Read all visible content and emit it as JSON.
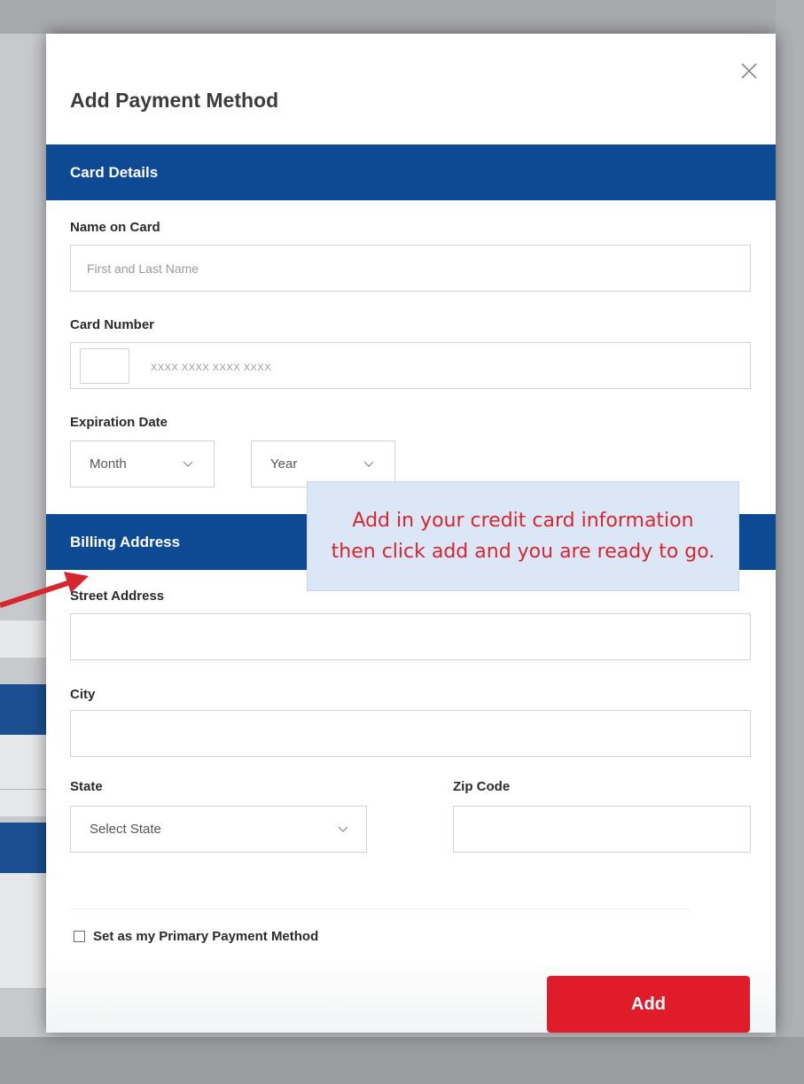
{
  "modal": {
    "title": "Add Payment Method",
    "close_icon": "close-icon"
  },
  "card_details": {
    "section_title": "Card Details",
    "name_label": "Name on Card",
    "name_placeholder": "First and Last Name",
    "number_label": "Card Number",
    "number_placeholder": "XXXX XXXX XXXX XXXX",
    "card_icon": "card-type-icon",
    "expiration_label": "Expiration Date",
    "month_value": "Month",
    "year_value": "Year"
  },
  "billing": {
    "section_title": "Billing Address",
    "street_label": "Street Address",
    "city_label": "City",
    "state_label": "State",
    "state_value": "Select State",
    "zip_label": "Zip Code"
  },
  "primary_checkbox_label": "Set as my Primary Payment Method",
  "add_button_label": "Add",
  "callout": {
    "text": "Add in your credit card information then click add and you are ready to go."
  },
  "colors": {
    "section_bar": "#0d4a93",
    "add_button": "#e11c2a",
    "callout_bg": "#dbe7f6",
    "callout_text": "#d6262f",
    "arrow": "#d6262f"
  }
}
